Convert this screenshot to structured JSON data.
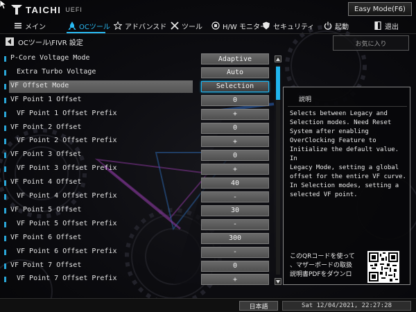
{
  "brand": {
    "name": "TAICHI",
    "sub": "UEFI"
  },
  "easy_mode": "Easy Mode(F6)",
  "nav": [
    {
      "label": "メイン",
      "icon": "menu-icon"
    },
    {
      "label": "OCツール",
      "icon": "rocket-icon"
    },
    {
      "label": "アドバンスド",
      "icon": "star-icon"
    },
    {
      "label": "ツール",
      "icon": "tools-icon"
    },
    {
      "label": "H/W モニター",
      "icon": "monitor-icon"
    },
    {
      "label": "セキュリティ",
      "icon": "shield-icon"
    },
    {
      "label": "起動",
      "icon": "power-icon"
    },
    {
      "label": "退出",
      "icon": "exit-icon"
    }
  ],
  "breadcrumb": "OCツール\\FIVR 設定",
  "favorite": "お気に入り",
  "settings": [
    {
      "label": "P-Core Voltage Mode",
      "value": "Adaptive",
      "level": 0
    },
    {
      "label": "Extra Turbo Voltage",
      "value": "Auto",
      "level": 1
    },
    {
      "label": "VF Offset Mode",
      "value": "Selection",
      "level": 0,
      "selected": true
    },
    {
      "label": "VF Point 1 Offset",
      "value": "0",
      "level": 0
    },
    {
      "label": "VF Point 1 Offset Prefix",
      "value": "+",
      "level": 1
    },
    {
      "label": "VF Point 2 Offset",
      "value": "0",
      "level": 0
    },
    {
      "label": "VF Point 2 Offset Prefix",
      "value": "+",
      "level": 1
    },
    {
      "label": "VF Point 3 Offset",
      "value": "0",
      "level": 0
    },
    {
      "label": "VF Point 3 Offset Prefix",
      "value": "+",
      "level": 1
    },
    {
      "label": "VF Point 4 Offset",
      "value": "40",
      "level": 0
    },
    {
      "label": "VF Point 4 Offset Prefix",
      "value": "-",
      "level": 1
    },
    {
      "label": "VF Point 5 Offset",
      "value": "30",
      "level": 0
    },
    {
      "label": "VF Point 5 Offset Prefix",
      "value": "-",
      "level": 1
    },
    {
      "label": "VF Point 6 Offset",
      "value": "300",
      "level": 0
    },
    {
      "label": "VF Point 6 Offset Prefix",
      "value": "-",
      "level": 1
    },
    {
      "label": "VF Point 7 Offset",
      "value": "0",
      "level": 0
    },
    {
      "label": "VF Point 7 Offset Prefix",
      "value": "+",
      "level": 1
    }
  ],
  "description": {
    "title": "説明",
    "lines": [
      "Selects between Legacy and",
      "Selection modes. Need Reset",
      "System after enabling",
      "OverClocking Feature to",
      "Initialize the default value. In",
      "Legacy Mode, setting a global",
      "offset for the entire VF curve.",
      "In Selection modes, setting a",
      "selected VF point."
    ],
    "qr_lines": [
      "このQRコードを使って",
      "、マザーボードの取扱",
      "説明書PDFをダウンロ"
    ]
  },
  "footer": {
    "language": "日本語",
    "datetime": "Sat 12/04/2021, 22:27:28"
  },
  "colors": {
    "accent": "#29b9f2",
    "background": "#0c0c10"
  }
}
